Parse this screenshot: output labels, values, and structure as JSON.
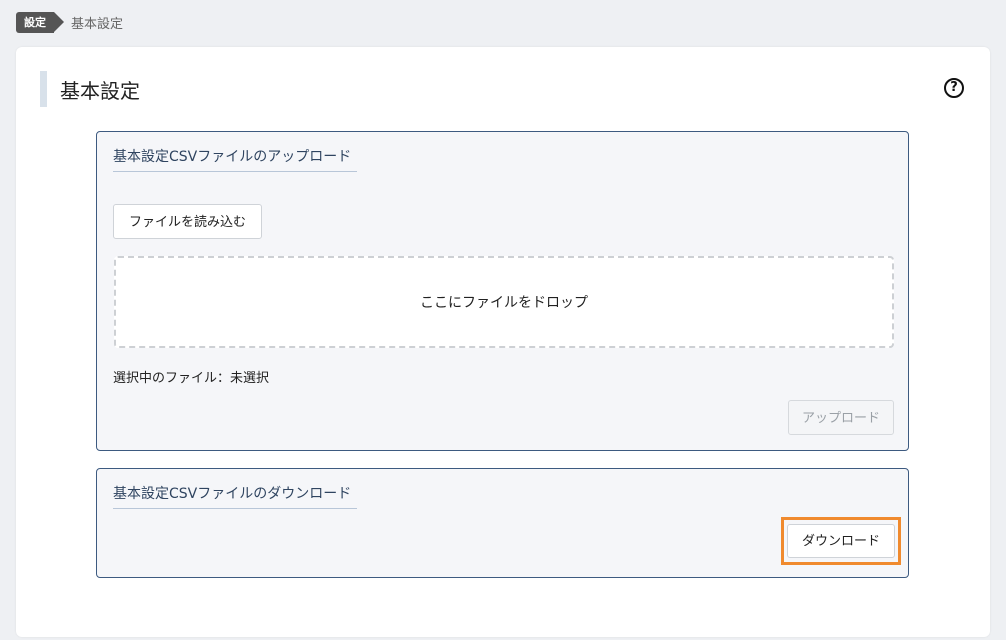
{
  "breadcrumb": {
    "parent": "設定",
    "current": "基本設定"
  },
  "page": {
    "title": "基本設定",
    "help_icon_label": "?"
  },
  "upload_panel": {
    "heading": "基本設定CSVファイルのアップロード",
    "file_button_label": "ファイルを読み込む",
    "dropzone_text": "ここにファイルをドロップ",
    "selected_file_text": "選択中のファイル：未選択",
    "upload_button_label": "アップロード",
    "upload_button_state": "disabled"
  },
  "download_panel": {
    "heading": "基本設定CSVファイルのダウンロード",
    "download_button_label": "ダウンロード",
    "highlight_color": "#f08a2e"
  },
  "colors": {
    "panel_border": "#3d5a80",
    "panel_background": "#f5f6f9",
    "page_background": "#eef0f3"
  }
}
